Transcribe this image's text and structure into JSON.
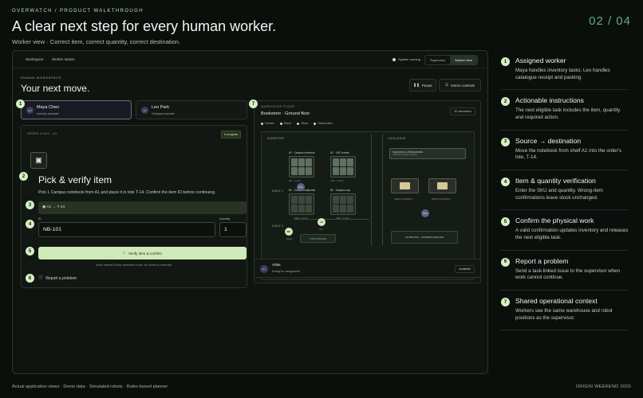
{
  "header": {
    "eyebrow": "OVERWATCH / PRODUCT WALKTHROUGH",
    "title": "A clear next step for every human worker.",
    "subtitle": "Worker view · Correct item, correct quantity, correct destination.",
    "counter": "02 / 04"
  },
  "app": {
    "tabs": [
      "Workspace",
      "Worker station"
    ],
    "system_status": "System running",
    "view_options": [
      "Supervisor",
      "Worker view"
    ],
    "active_view": "Worker view",
    "workspace_eyebrow": "HUMAN WORKSPACE",
    "workspace_title": "Your next move.",
    "pause_label": "Pause",
    "demo_label": "Demo controls",
    "workers": [
      {
        "initials": "MC",
        "name": "Maya Chen",
        "role": "Inventory associate"
      },
      {
        "initials": "LP",
        "name": "Leo Park",
        "role": "Catalogue associate"
      }
    ],
    "order": {
      "id": "ORDER #1042 · A1",
      "status": "In progress",
      "title": "Pick & verify item",
      "description": "Pick 1 Campus notebook from A1 and place it in tote T-14. Confirm the item ID before continuing.",
      "route": "A1 → T-14",
      "id_label": "ID",
      "id_value": "NB-101",
      "qty_label": "Quantity",
      "qty_value": "1",
      "verify_label": "Verify item & confirm",
      "note": "Demo: manual ID entry represents a scan. No camera is connected.",
      "report_label": "Report a problem"
    },
    "floor": {
      "eyebrow": "WAREHOUSE FLOOR",
      "title": "Bookstore · Ground floor",
      "sim_label": "2D simulation",
      "legend": [
        "Human",
        "Robot",
        "Stock",
        "Obstruction"
      ],
      "zones": {
        "inventory": "INVENTORY",
        "catalogue": "CATALOGUE",
        "aisle_1": "AISLE 1",
        "aisle_2": "AISLE 2"
      },
      "shelves": [
        {
          "label": "A1 · Campus notebook",
          "sub": "NB · 4 units"
        },
        {
          "label": "A2 · VSC bundle",
          "sub": "VSC · 4 units"
        },
        {
          "label": "B1 · Campus ballpoints",
          "sub": "PEN · 9 units"
        },
        {
          "label": "B2 · Campus cap",
          "sub": "CAP · 3 units"
        }
      ],
      "station": "CHECKING & PROCESSING",
      "station_sub": "Verification before packing",
      "crates": [
        "INBOX STAGING 1",
        "INBOX STAGING 2"
      ],
      "outbound": "OUTBOUND · CARRIER HANDOFF",
      "packing": "TOTE STAGING",
      "markers": {
        "robot_1": "R01",
        "robot_2": "R02",
        "human_1": "MC",
        "human_2": "LP"
      },
      "marker_labels": {
        "human_1": "Maya",
        "human_2": "Leo"
      }
    },
    "robot": {
      "initials": "R1",
      "name": "Atlas",
      "status": "Ready for assignment",
      "availability": "Available"
    }
  },
  "steps": [
    {
      "n": "1",
      "title": "Assigned worker",
      "desc": "Maya handles inventory tasks; Leo handles catalogue receipt and packing."
    },
    {
      "n": "2",
      "title": "Actionable instructions",
      "desc": "The next eligible task includes the item, quantity and required action."
    },
    {
      "n": "3",
      "title": "Source → destination",
      "desc": "Move the notebook from shelf A1 into the order's tote, T-14."
    },
    {
      "n": "4",
      "title": "Item & quantity verification",
      "desc": "Enter the SKU and quantity. Wrong-item confirmations leave stock unchanged."
    },
    {
      "n": "5",
      "title": "Confirm the physical work",
      "desc": "A valid confirmation updates inventory and releases the next eligible task."
    },
    {
      "n": "6",
      "title": "Report a problem",
      "desc": "Send a task-linked issue to the supervisor when work cannot continue."
    },
    {
      "n": "7",
      "title": "Shared operational context",
      "desc": "Workers see the same warehouse and robot positions as the supervisor."
    }
  ],
  "callouts": [
    "1",
    "2",
    "3",
    "4",
    "5",
    "6",
    "7"
  ],
  "footer": {
    "left": "Actual application views · Demo data · Simulated robots · Rules-based planner",
    "right": "ORIGIN WEEKEND 2026"
  },
  "icons": [
    "pause-icon",
    "sliders-icon",
    "scan-icon",
    "pin-icon",
    "check-icon",
    "alert-icon"
  ]
}
